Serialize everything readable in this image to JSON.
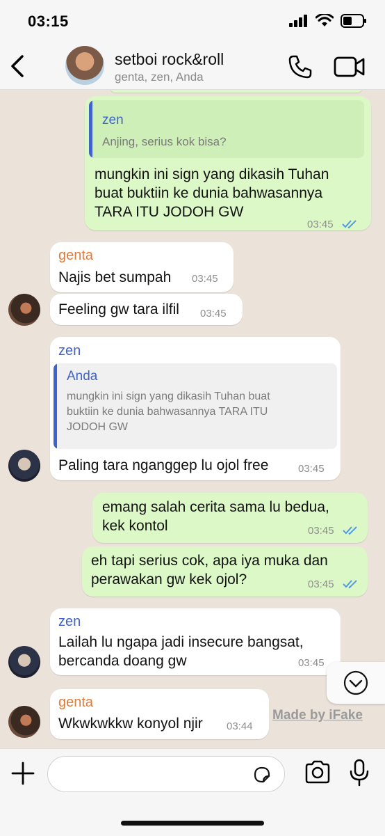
{
  "status": {
    "time": "03:15"
  },
  "header": {
    "title": "setboi rock&roll",
    "subtitle": "genta, zen, Anda"
  },
  "colors": {
    "genta": "#e07b39",
    "zen": "#3f63c9",
    "anda": "#3f63c9",
    "ticks": "#4f9be8",
    "outgoing": "#dcf8c6",
    "incoming": "#ffffff"
  },
  "messages": [
    {
      "quote_name": "zen",
      "quote_text": "Anjing, serius kok bisa?",
      "line1": "mungkin ini sign yang dikasih Tuhan",
      "line2": "buat buktiin ke dunia bahwasannya",
      "line3": "TARA ITU JODOH GW",
      "time": "03:45"
    },
    {
      "sender": "genta",
      "text": "Najis bet sumpah",
      "time": "03:45"
    },
    {
      "text": "Feeling gw tara ilfil",
      "time": "03:45"
    },
    {
      "sender": "zen",
      "quote_name": "Anda",
      "quote_line1": "mungkin ini sign yang dikasih Tuhan buat",
      "quote_line2": "buktiin ke dunia bahwasannya TARA ITU",
      "quote_line3": "JODOH GW",
      "text": "Paling tara nganggep lu ojol free",
      "time": "03:45"
    },
    {
      "line1": "emang salah cerita sama lu bedua,",
      "line2": "kek kontol",
      "time": "03:45"
    },
    {
      "line1": "eh tapi serius cok, apa iya muka dan",
      "line2": "perawakan gw kek ojol?",
      "time": "03:45"
    },
    {
      "sender": "zen",
      "line1": "Lailah lu ngapa jadi insecure bangsat,",
      "line2": "bercanda doang gw",
      "time": "03:45"
    },
    {
      "sender": "genta",
      "text": "Wkwkwkkw konyol njir",
      "time": "03:44"
    }
  ],
  "watermark": "Made by iFake",
  "icons": [
    "back-chevron-icon",
    "phone-icon",
    "video-icon",
    "scroll-down-icon",
    "plus-icon",
    "sticker-icon",
    "camera-icon",
    "mic-icon"
  ]
}
